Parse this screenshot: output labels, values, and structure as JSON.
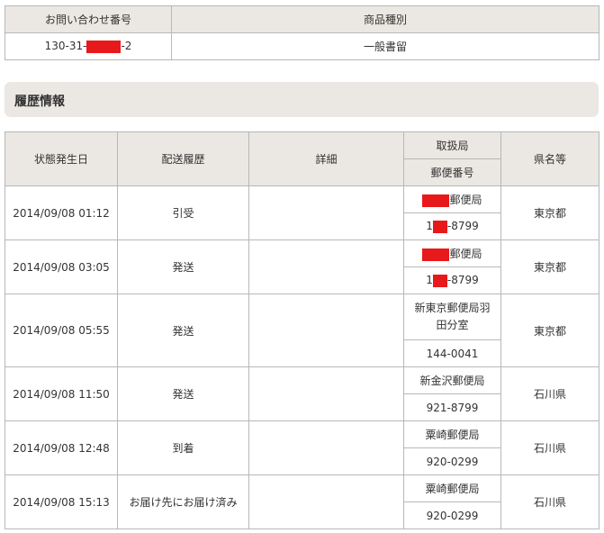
{
  "summary": {
    "headers": {
      "inquiry_number": "お問い合わせ番号",
      "item_type": "商品種別"
    },
    "inquiry_number": {
      "prefix": "130-31-",
      "suffix": "-2"
    },
    "item_type": "一般書留"
  },
  "section_title": "履歴情報",
  "history": {
    "headers": {
      "date": "状態発生日",
      "status": "配送履歴",
      "details": "詳細",
      "office": "取扱局",
      "postal_code": "郵便番号",
      "prefecture": "県名等"
    },
    "rows": [
      {
        "date": "2014/09/08 01:12",
        "status": "引受",
        "details": "",
        "office_prefix": "",
        "office": "郵便局",
        "postal_prefix": "1",
        "postal": "-8799",
        "prefecture": "東京都"
      },
      {
        "date": "2014/09/08 03:05",
        "status": "発送",
        "details": "",
        "office_prefix": "",
        "office": "郵便局",
        "postal_prefix": "1",
        "postal": "-8799",
        "prefecture": "東京都"
      },
      {
        "date": "2014/09/08 05:55",
        "status": "発送",
        "details": "",
        "office": "新東京郵便局羽田分室",
        "postal": "144-0041",
        "prefecture": "東京都"
      },
      {
        "date": "2014/09/08 11:50",
        "status": "発送",
        "details": "",
        "office": "新金沢郵便局",
        "postal": "921-8799",
        "prefecture": "石川県"
      },
      {
        "date": "2014/09/08 12:48",
        "status": "到着",
        "details": "",
        "office": "粟崎郵便局",
        "postal": "920-0299",
        "prefecture": "石川県"
      },
      {
        "date": "2014/09/08 15:13",
        "status": "お届け先にお届け済み",
        "details": "",
        "office": "粟崎郵便局",
        "postal": "920-0299",
        "prefecture": "石川県"
      }
    ]
  }
}
